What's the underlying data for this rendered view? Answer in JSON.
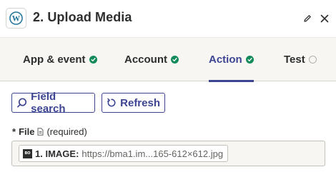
{
  "header": {
    "app_icon": "wordpress-icon",
    "title": "2. Upload Media",
    "edit_icon": "pencil-icon",
    "close_icon": "close-icon"
  },
  "tabs": [
    {
      "label": "App & event",
      "status": "complete"
    },
    {
      "label": "Account",
      "status": "complete"
    },
    {
      "label": "Action",
      "status": "complete",
      "active": true
    },
    {
      "label": "Test",
      "status": "incomplete"
    }
  ],
  "toolbar": {
    "field_search_label": "Field search",
    "refresh_label": "Refresh"
  },
  "field": {
    "required_marker": "*",
    "label": "File",
    "required_text": "(required)",
    "token": {
      "icon_text": "BO",
      "key": "1. IMAGE:",
      "value": "https://bma1.im...165-612×612.jpg"
    }
  },
  "colors": {
    "accent": "#3d4592",
    "success": "#138a5a",
    "tab_background": "#f7f6f3"
  }
}
